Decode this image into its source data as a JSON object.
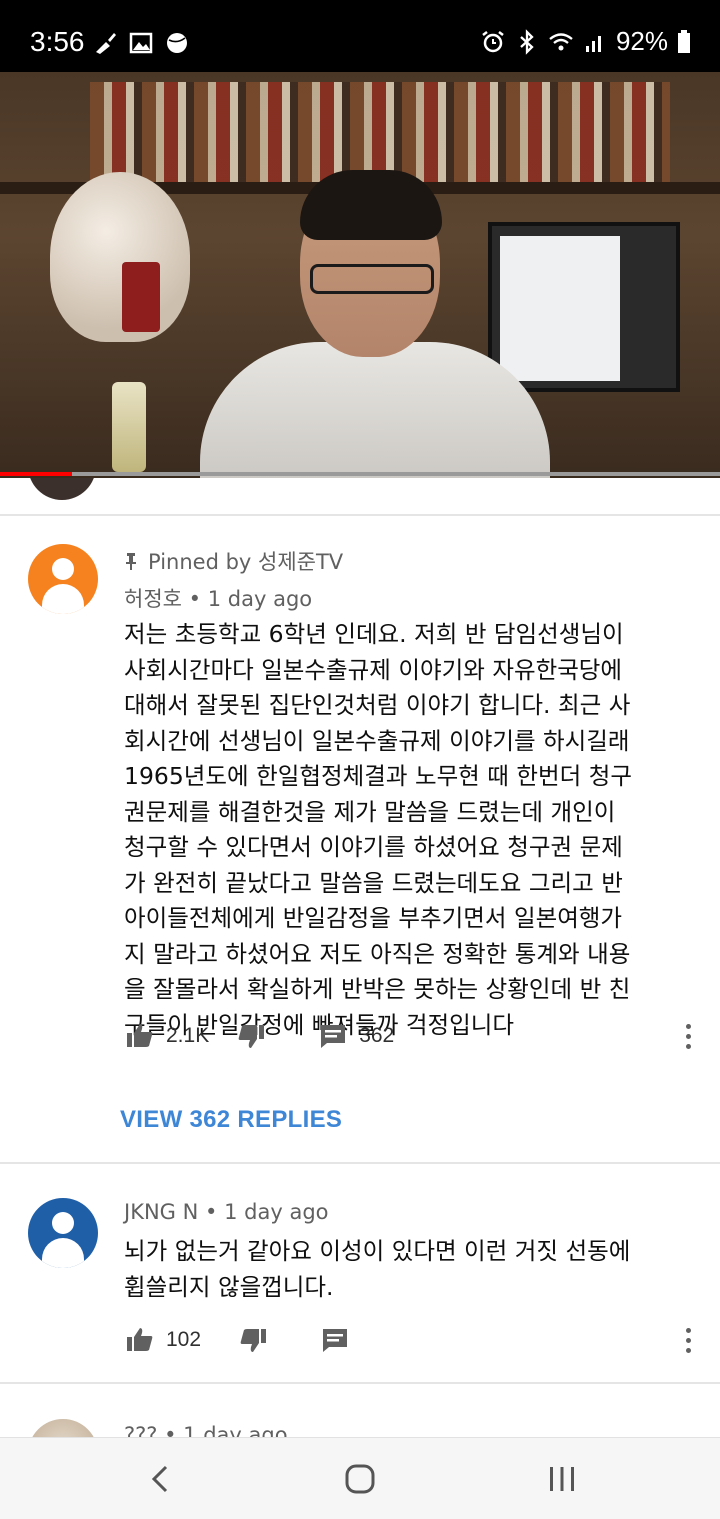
{
  "status_bar": {
    "time": "3:56",
    "battery": "92%"
  },
  "video": {
    "progress": 0.1
  },
  "comments": [
    {
      "pinned_label": "Pinned by 성제준TV",
      "author": "허정호",
      "separator": "•",
      "age": "1 day ago",
      "text": "저는 초등학교 6학년 인데요. 저희 반 담임선생님이\n사회시간마다 일본수출규제 이야기와 자유한국당에\n대해서 잘못된 집단인것처럼 이야기 합니다. 최근 사\n회시간에 선생님이 일본수출규제 이야기를 하시길래\n1965년도에 한일협정체결과 노무현 때 한번더 청구\n권문제를 해결한것을 제가 말씀을 드렸는데 개인이\n청구할 수 있다면서 이야기를 하셨어요 청구권 문제\n가 완전히 끝났다고 말씀을 드렸는데도요 그리고 반\n아이들전체에게 반일감정을 부추기면서 일본여행가\n지 말라고 하셨어요 저도 아직은 정확한 통계와 내용\n을 잘몰라서 확실하게 반박은 못하는 상황인데 반 친\n구들이 반일감정에 빠져들까 걱정입니다",
      "likes": "2.1K",
      "replies": "362",
      "view_replies": "VIEW 362 REPLIES",
      "avatar_color": "#f5821f"
    },
    {
      "author": "JKNG N",
      "separator": "•",
      "age": "1 day ago",
      "text": "뇌가 없는거 같아요 이성이 있다면 이런 거짓 선동에\n휩쓸리지 않을껍니다.",
      "likes": "102",
      "avatar_color": "#1f5fa8"
    }
  ],
  "peek_comment": {
    "meta": "??? • 1 day ago"
  },
  "icons": [
    "broom-icon",
    "image-icon",
    "ball-icon",
    "alarm-icon",
    "bluetooth-icon",
    "wifi-icon",
    "signal-icon",
    "battery-icon",
    "pin-icon",
    "thumbs-up-icon",
    "thumbs-down-icon",
    "reply-icon",
    "more-icon",
    "back-icon",
    "home-icon",
    "recents-icon"
  ],
  "colors": {
    "link": "#3e86d6",
    "progress": "#ff0000"
  }
}
